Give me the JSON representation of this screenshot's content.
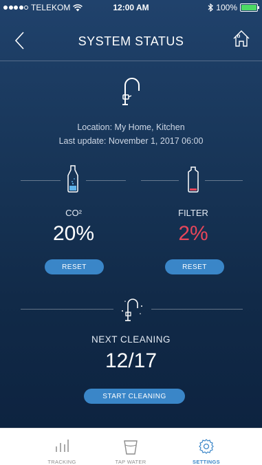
{
  "status_bar": {
    "carrier": "TELEKOM",
    "time": "12:00 AM",
    "battery": "100%",
    "battery_color": "#4cd964"
  },
  "nav": {
    "title": "SYSTEM STATUS",
    "back_icon": "chevron-left-icon",
    "home_icon": "home-icon"
  },
  "info": {
    "location": "Location: My Home, Kitchen",
    "last_update": "Last update: November 1, 2017 06:00"
  },
  "co2": {
    "label": "CO²",
    "value": "20%",
    "level": 0.2,
    "button": "RESET",
    "value_color": "#ffffff"
  },
  "filter": {
    "label": "FILTER",
    "value": "2%",
    "level": 0.02,
    "button": "RESET",
    "value_color": "#e8465a"
  },
  "cleaning": {
    "label": "NEXT CLEANING",
    "value": "12/17",
    "button": "START CLEANING"
  },
  "tabs": [
    {
      "label": "TRACKING",
      "icon": "bar-chart-icon",
      "active": false
    },
    {
      "label": "TAP WATER",
      "icon": "glass-icon",
      "active": false
    },
    {
      "label": "SETTINGS",
      "icon": "gear-icon",
      "active": true
    }
  ],
  "colors": {
    "accent": "#3a86c8",
    "background": "#183659"
  }
}
